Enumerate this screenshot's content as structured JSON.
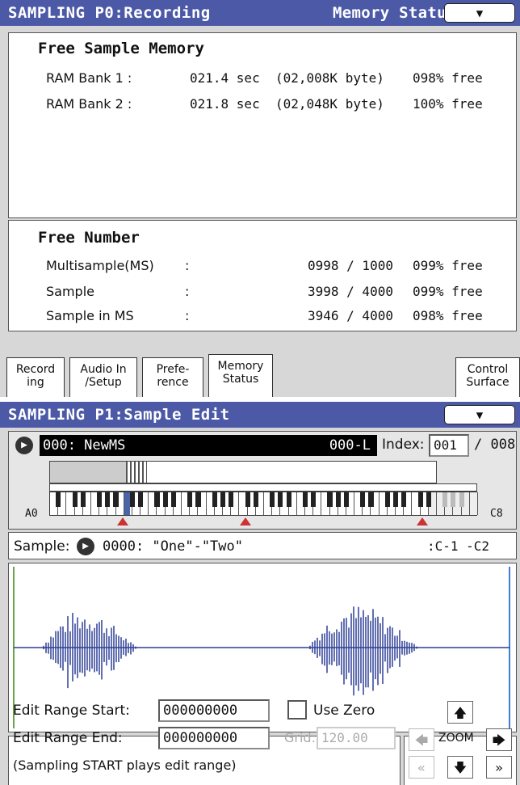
{
  "page1": {
    "title": "SAMPLING P0:Recording",
    "tab_title": "Memory Status",
    "menu_icon": "▼",
    "free_sample_memory": {
      "heading": "Free Sample Memory",
      "rows": [
        {
          "label": "RAM Bank 1 :",
          "sec": "021.4 sec",
          "bytes": "(02,008K byte)",
          "free": "098% free"
        },
        {
          "label": "RAM Bank 2 :",
          "sec": "021.8 sec",
          "bytes": "(02,048K byte)",
          "free": "100% free"
        }
      ]
    },
    "free_number": {
      "heading": "Free Number",
      "rows": [
        {
          "label": "Multisample(MS)",
          "colon": ":",
          "count": "0998 / 1000",
          "free": "099% free"
        },
        {
          "label": "Sample",
          "colon": ":",
          "count": "3998 / 4000",
          "free": "099% free"
        },
        {
          "label": "Sample in MS",
          "colon": ":",
          "count": "3946 / 4000",
          "free": "098% free"
        }
      ]
    },
    "tabs": [
      {
        "line1": "Record",
        "line2": "ing"
      },
      {
        "line1": "Audio In",
        "line2": "/Setup"
      },
      {
        "line1": "Prefe-",
        "line2": "rence"
      },
      {
        "line1": "Memory",
        "line2": "Status"
      },
      {
        "line1": "Control",
        "line2": "Surface"
      }
    ]
  },
  "page2": {
    "title": "SAMPLING P1:Sample Edit",
    "menu_icon": "▼",
    "multisample": "000: NewMS",
    "multisample_suffix": "000-L",
    "index_label": "Index:",
    "index_value": "001",
    "index_total": "/ 008",
    "key_low": "A0",
    "key_high": "C8",
    "sample_label": "Sample:",
    "sample_value": "0000: \"One\"-\"Two\"",
    "sample_range": ":C-1 -C2",
    "edit_range_start_label": "Edit Range Start:",
    "edit_range_start_value": "000000000",
    "edit_range_end_label": "Edit Range End:",
    "edit_range_end_value": "000000000",
    "use_zero_label": "Use Zero",
    "grid_label": "Grid:",
    "grid_value": "120.00",
    "note": "(Sampling START plays edit range)",
    "zoom_label": "ZOOM"
  }
}
